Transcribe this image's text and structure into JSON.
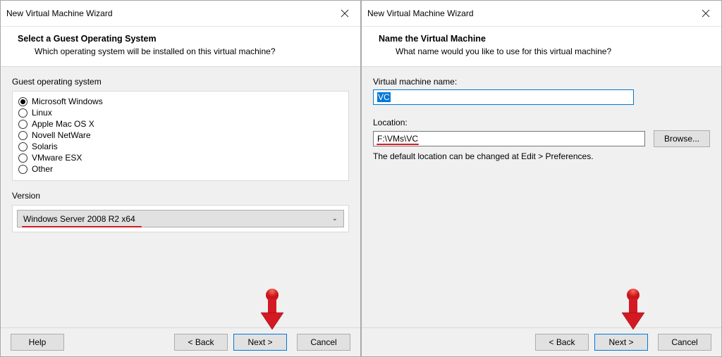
{
  "left": {
    "window_title": "New Virtual Machine Wizard",
    "step_title": "Select a Guest Operating System",
    "step_subtitle": "Which operating system will be installed on this virtual machine?",
    "os_section_label": "Guest operating system",
    "radios": [
      {
        "label": "Microsoft Windows",
        "selected": true
      },
      {
        "label": "Linux",
        "selected": false
      },
      {
        "label": "Apple Mac OS X",
        "selected": false
      },
      {
        "label": "Novell NetWare",
        "selected": false
      },
      {
        "label": "Solaris",
        "selected": false
      },
      {
        "label": "VMware ESX",
        "selected": false
      },
      {
        "label": "Other",
        "selected": false
      }
    ],
    "version_label": "Version",
    "version_selected": "Windows Server 2008 R2 x64",
    "buttons": {
      "help": "Help",
      "back": "< Back",
      "next": "Next >",
      "cancel": "Cancel"
    }
  },
  "right": {
    "window_title": "New Virtual Machine Wizard",
    "step_title": "Name the Virtual Machine",
    "step_subtitle": "What name would you like to use for this virtual machine?",
    "name_label": "Virtual machine name:",
    "name_value": "VC",
    "location_label": "Location:",
    "location_value": "F:\\VMs\\VC",
    "browse_label": "Browse...",
    "note": "The default location can be changed at Edit > Preferences.",
    "buttons": {
      "back": "< Back",
      "next": "Next >",
      "cancel": "Cancel"
    }
  }
}
